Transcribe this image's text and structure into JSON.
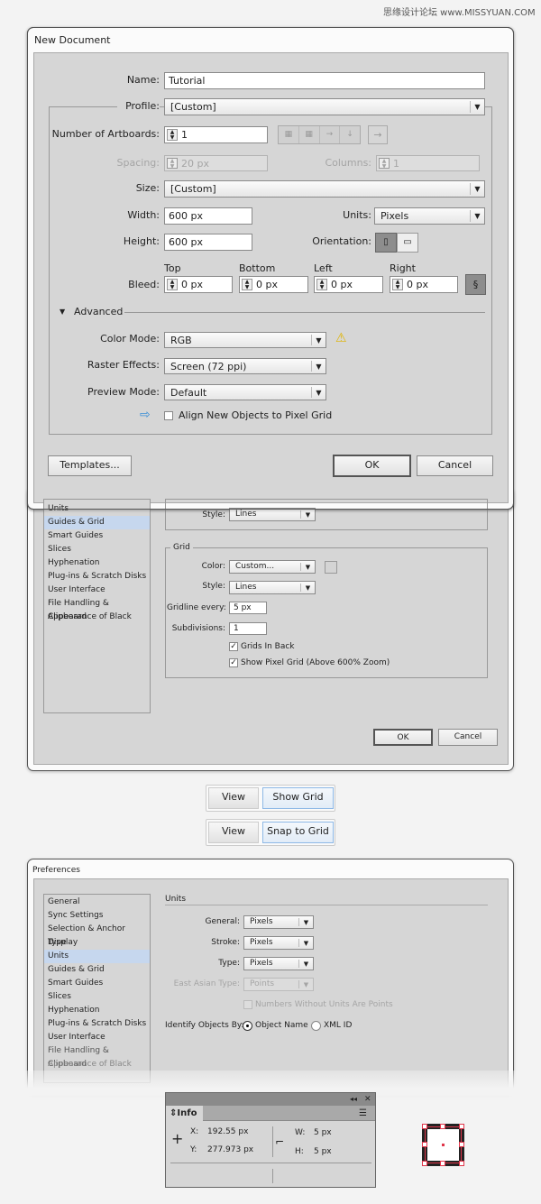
{
  "watermark": "思缘设计论坛 www.MISSYUAN.COM",
  "new_doc": {
    "title": "New Document",
    "name_label": "Name:",
    "name_value": "Tutorial",
    "profile_label": "Profile:",
    "profile_value": "[Custom]",
    "artboards_label": "Number of Artboards:",
    "artboards_value": "1",
    "spacing_label": "Spacing:",
    "spacing_value": "20 px",
    "columns_label": "Columns:",
    "columns_value": "1",
    "size_label": "Size:",
    "size_value": "[Custom]",
    "width_label": "Width:",
    "width_value": "600 px",
    "units_label": "Units:",
    "units_value": "Pixels",
    "height_label": "Height:",
    "height_value": "600 px",
    "orientation_label": "Orientation:",
    "bleed_label": "Bleed:",
    "bleed": [
      {
        "label": "Top",
        "value": "0 px"
      },
      {
        "label": "Bottom",
        "value": "0 px"
      },
      {
        "label": "Left",
        "value": "0 px"
      },
      {
        "label": "Right",
        "value": "0 px"
      }
    ],
    "advanced_label": "Advanced",
    "color_mode_label": "Color Mode:",
    "color_mode_value": "RGB",
    "raster_label": "Raster Effects:",
    "raster_value": "Screen (72 ppi)",
    "preview_label": "Preview Mode:",
    "preview_value": "Default",
    "align_label": "Align New Objects to Pixel Grid",
    "align_checked": false,
    "templates_button": "Templates...",
    "ok_button": "OK",
    "cancel_button": "Cancel"
  },
  "guides_prefs": {
    "sidebar": [
      "Units",
      "Guides & Grid",
      "Smart Guides",
      "Slices",
      "Hyphenation",
      "Plug-ins & Scratch Disks",
      "User Interface",
      "File Handling & Clipboard",
      "Appearance of Black"
    ],
    "selected": "Guides & Grid",
    "guides_style_label": "Style:",
    "guides_style_value": "Lines",
    "grid_legend": "Grid",
    "color_label": "Color:",
    "color_value": "Custom...",
    "style_label": "Style:",
    "style_value": "Lines",
    "gridline_label": "Gridline every:",
    "gridline_value": "5 px",
    "subdiv_label": "Subdivisions:",
    "subdiv_value": "1",
    "grids_in_back": "Grids In Back",
    "show_pixel_grid": "Show Pixel Grid (Above 600% Zoom)",
    "ok_button": "OK",
    "cancel_button": "Cancel"
  },
  "menu1": {
    "view": "View",
    "item": "Show Grid"
  },
  "menu2": {
    "view": "View",
    "item": "Snap to Grid"
  },
  "units_prefs": {
    "title": "Preferences",
    "sidebar": [
      "General",
      "Sync Settings",
      "Selection & Anchor Display",
      "Type",
      "Units",
      "Guides & Grid",
      "Smart Guides",
      "Slices",
      "Hyphenation",
      "Plug-ins & Scratch Disks",
      "User Interface",
      "File Handling & Clipboard",
      "Appearance of Black"
    ],
    "selected": "Units",
    "section": "Units",
    "general_label": "General:",
    "general_value": "Pixels",
    "stroke_label": "Stroke:",
    "stroke_value": "Pixels",
    "type_label": "Type:",
    "type_value": "Pixels",
    "east_asian_label": "East Asian Type:",
    "east_asian_value": "Points",
    "numbers_label": "Numbers Without Units Are Points",
    "identify_label": "Identify Objects By:",
    "object_name": "Object Name",
    "xml_id": "XML ID"
  },
  "info": {
    "tab": "Info",
    "x_label": "X:",
    "x_value": "192.55 px",
    "y_label": "Y:",
    "y_value": "277.973 px",
    "w_label": "W:",
    "w_value": "5 px",
    "h_label": "H:",
    "h_value": "5 px"
  },
  "colors": {
    "selection_highlight": "#c6d7ee",
    "accent_red": "#e0354a"
  }
}
